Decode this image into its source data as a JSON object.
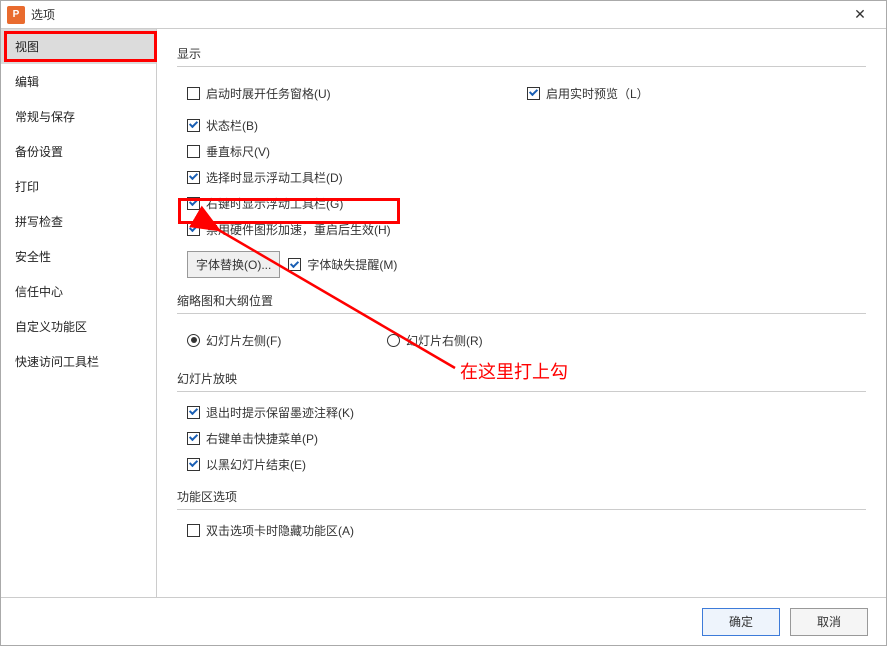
{
  "window": {
    "title": "选项",
    "app_icon_letter": "P"
  },
  "sidebar": {
    "items": [
      {
        "label": "视图",
        "selected": true
      },
      {
        "label": "编辑"
      },
      {
        "label": "常规与保存"
      },
      {
        "label": "备份设置"
      },
      {
        "label": "打印"
      },
      {
        "label": "拼写检查"
      },
      {
        "label": "安全性"
      },
      {
        "label": "信任中心"
      },
      {
        "label": "自定义功能区"
      },
      {
        "label": "快速访问工具栏"
      }
    ]
  },
  "sections": {
    "display": {
      "title": "显示",
      "opts": {
        "startup_pane": "启动时展开任务窗格(U)",
        "realtime_preview": "启用实时预览（L）",
        "status_bar": "状态栏(B)",
        "vertical_ruler": "垂直标尺(V)",
        "select_float_toolbar": "选择时显示浮动工具栏(D)",
        "rclick_float_toolbar": "右键时显示浮动工具栏(G)",
        "disable_hw_accel": "禁用硬件图形加速，重启后生效(H)"
      },
      "font_replace_btn": "字体替换(O)...",
      "font_missing": "字体缺失提醒(M)"
    },
    "thumb": {
      "title": "缩略图和大纲位置",
      "left": "幻灯片左侧(F)",
      "right": "幻灯片右侧(R)"
    },
    "slideshow": {
      "title": "幻灯片放映",
      "exit_ink": "退出时提示保留墨迹注释(K)",
      "rclick_menu": "右键单击快捷菜单(P)",
      "black_end": "以黑幻灯片结束(E)"
    },
    "ribbon": {
      "title": "功能区选项",
      "dblclick_hide": "双击选项卡时隐藏功能区(A)"
    }
  },
  "footer": {
    "ok": "确定",
    "cancel": "取消"
  },
  "annotation": {
    "text": "在这里打上勾"
  }
}
